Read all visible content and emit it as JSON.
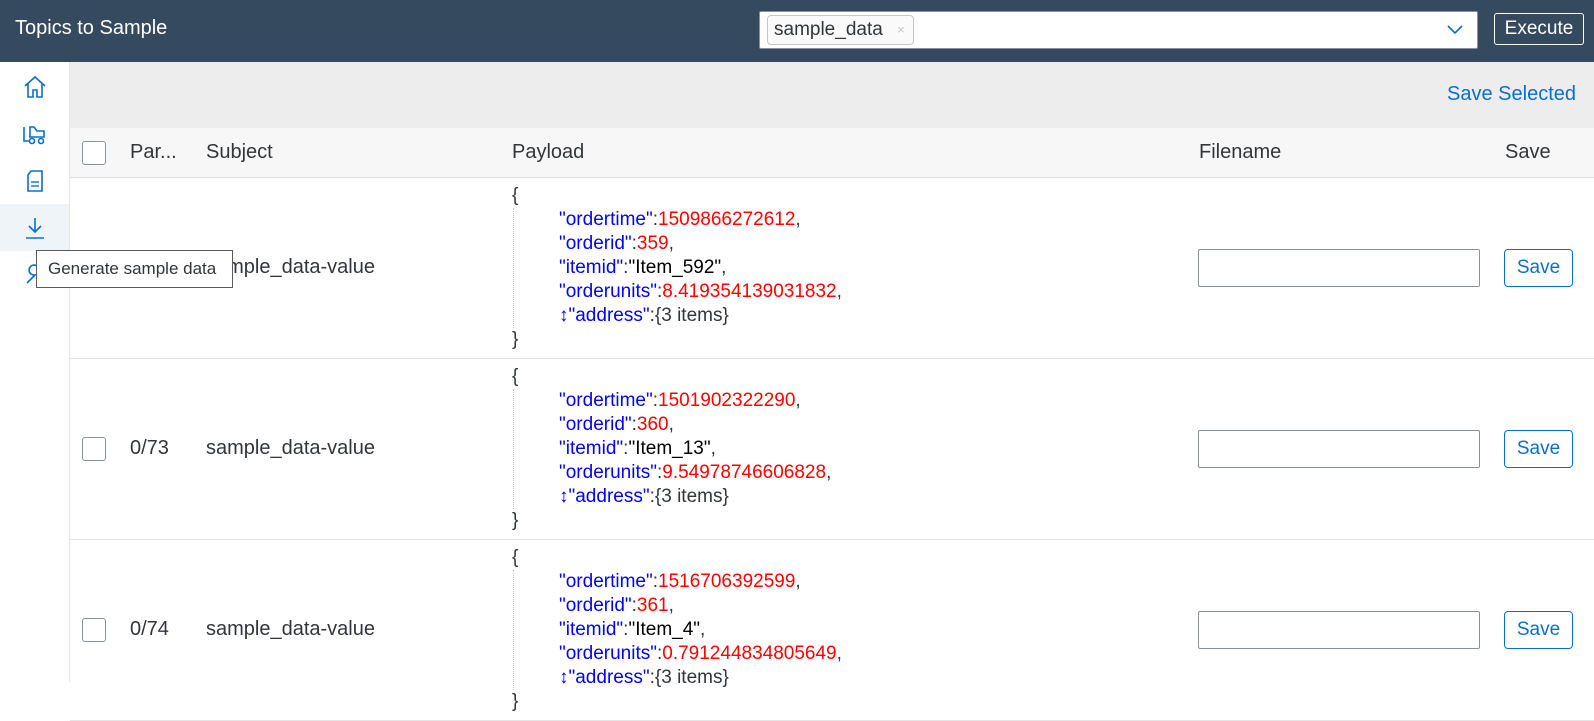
{
  "header": {
    "title": "Topics to Sample",
    "selected_topic": "sample_data",
    "token_remove": "×",
    "execute_label": "Execute"
  },
  "sidenav": {
    "items": [
      {
        "icon": "home-icon"
      },
      {
        "icon": "forklift-icon"
      },
      {
        "icon": "document-icon"
      },
      {
        "icon": "download-icon",
        "active": true
      },
      {
        "icon": "wrench-icon"
      }
    ],
    "tooltip": "Generate sample data"
  },
  "toolbar": {
    "save_selected": "Save Selected"
  },
  "table": {
    "columns": [
      "Par...",
      "Subject",
      "Payload",
      "Filename",
      "Save"
    ],
    "rows": [
      {
        "partition": "",
        "subject": "sample_data-value",
        "payload": {
          "open": "{",
          "close": "}",
          "ordertime_key": "\"ordertime\"",
          "ordertime": "1509866272612",
          "orderid_key": "\"orderid\"",
          "orderid": "359",
          "itemid_key": "\"itemid\"",
          "itemid": "\"Item_592\"",
          "orderunits_key": "\"orderunits\"",
          "orderunits": "8.419354139031832",
          "address_key": "↕\"address\"",
          "address": "{3 items}"
        },
        "save_label": "Save"
      },
      {
        "partition": "0/73",
        "subject": "sample_data-value",
        "payload": {
          "open": "{",
          "close": "}",
          "ordertime_key": "\"ordertime\"",
          "ordertime": "1501902322290",
          "orderid_key": "\"orderid\"",
          "orderid": "360",
          "itemid_key": "\"itemid\"",
          "itemid": "\"Item_13\"",
          "orderunits_key": "\"orderunits\"",
          "orderunits": "9.54978746606828",
          "address_key": "↕\"address\"",
          "address": "{3 items}"
        },
        "save_label": "Save"
      },
      {
        "partition": "0/74",
        "subject": "sample_data-value",
        "payload": {
          "open": "{",
          "close": "}",
          "ordertime_key": "\"ordertime\"",
          "ordertime": "1516706392599",
          "orderid_key": "\"orderid\"",
          "orderid": "361",
          "itemid_key": "\"itemid\"",
          "itemid": "\"Item_4\"",
          "orderunits_key": "\"orderunits\"",
          "orderunits": "0.791244834805649",
          "address_key": "↕\"address\"",
          "address": "{3 items}"
        },
        "save_label": "Save"
      }
    ]
  }
}
